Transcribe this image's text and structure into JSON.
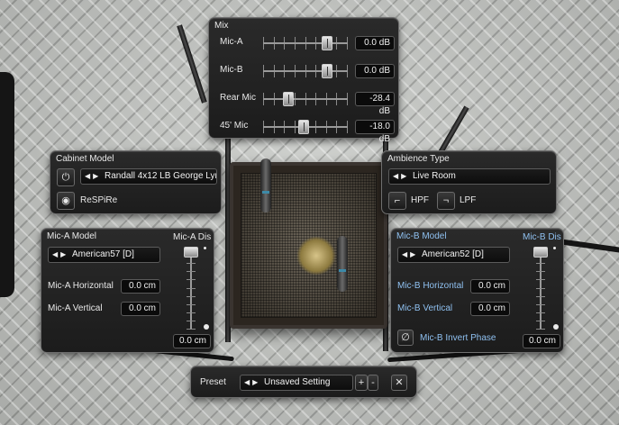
{
  "mix": {
    "title": "Mix",
    "channels": [
      {
        "label": "Mic-A",
        "value": "0.0 dB",
        "level": 0.79
      },
      {
        "label": "Mic-B",
        "value": "0.0 dB",
        "level": 0.79
      },
      {
        "label": "Rear Mic",
        "value": "-28.4 dB",
        "level": 0.27
      },
      {
        "label": "45' Mic",
        "value": "-18.0 dB",
        "level": 0.48
      }
    ]
  },
  "cabinet": {
    "title": "Cabinet Model",
    "model": "Randall 4x12 LB George Lynch",
    "respire_label": "ReSPiRe",
    "power_icon": "power-icon",
    "respire_icon": "respire-icon"
  },
  "ambience": {
    "title": "Ambience Type",
    "type": "Live Room",
    "hpf_label": "HPF",
    "lpf_label": "LPF"
  },
  "mic_a": {
    "title": "Mic-A Model",
    "model": "American57 [D]",
    "horizontal_label": "Mic-A Horizontal",
    "horizontal_value": "0.0 cm",
    "vertical_label": "Mic-A Vertical",
    "vertical_value": "0.0 cm",
    "distance_label": "Mic-A Dis",
    "distance_value": "0.0 cm",
    "distance_level": 1.0
  },
  "mic_b": {
    "title": "Mic-B Model",
    "model": "American52 [D]",
    "horizontal_label": "Mic-B Horizontal",
    "horizontal_value": "0.0 cm",
    "vertical_label": "Mic-B Vertical",
    "vertical_value": "0.0 cm",
    "distance_label": "Mic-B Dis",
    "distance_value": "0.0 cm",
    "distance_level": 1.0,
    "invert_label": "Mic-B Invert Phase"
  },
  "preset": {
    "label": "Preset",
    "value": "Unsaved Setting",
    "add_label": "+",
    "remove_label": "-",
    "close_label": "✕"
  },
  "colors": {
    "accent_blue": "#8fc0f0",
    "panel_bg": "#1f1f1f"
  }
}
